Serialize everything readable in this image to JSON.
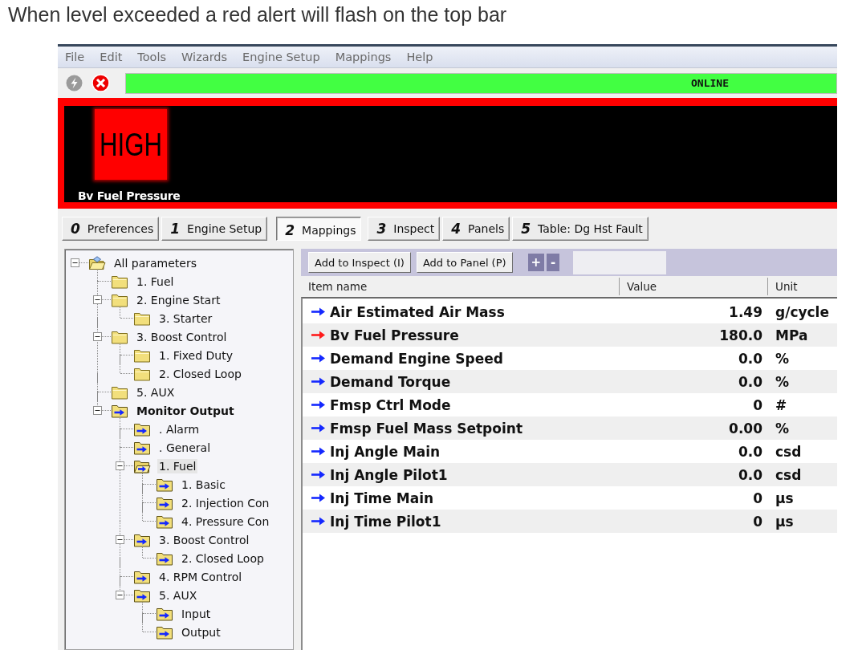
{
  "caption": "When level exceeded a red alert will flash on the top bar",
  "menu": [
    "File",
    "Edit",
    "Tools",
    "Wizards",
    "Engine Setup",
    "Mappings",
    "Help"
  ],
  "status": "ONLINE",
  "alert": {
    "badge": "HIGH",
    "parameter": "Bv Fuel Pressure"
  },
  "tabs": [
    {
      "number": "0",
      "label": "Preferences",
      "selected": false
    },
    {
      "number": "1",
      "label": "Engine Setup",
      "selected": false
    },
    {
      "number": "2",
      "label": "Mappings",
      "selected": true
    },
    {
      "number": "3",
      "label": "Inspect",
      "selected": false
    },
    {
      "number": "4",
      "label": "Panels",
      "selected": false
    },
    {
      "number": "5",
      "label": "Table: Dg Hst Fault",
      "selected": false
    }
  ],
  "tree": [
    {
      "label": "All parameters",
      "kind": "root",
      "expanded": true,
      "selected": false,
      "children": [
        {
          "label": "1. Fuel",
          "kind": "folder",
          "selected": false
        },
        {
          "label": "2. Engine Start",
          "kind": "folder",
          "expanded": true,
          "selected": false,
          "children": [
            {
              "label": "3. Starter",
              "kind": "folder",
              "selected": false
            }
          ]
        },
        {
          "label": "3. Boost Control",
          "kind": "folder",
          "expanded": true,
          "selected": false,
          "children": [
            {
              "label": "1. Fixed Duty",
              "kind": "folder",
              "selected": false
            },
            {
              "label": "2. Closed Loop",
              "kind": "folder",
              "selected": false
            }
          ]
        },
        {
          "label": "5. AUX",
          "kind": "folder",
          "selected": false
        },
        {
          "label": "Monitor Output",
          "kind": "output",
          "bold": true,
          "expanded": true,
          "selected": false,
          "children": [
            {
              "label": ". Alarm",
              "kind": "output",
              "selected": false
            },
            {
              "label": ". General",
              "kind": "output",
              "selected": false
            },
            {
              "label": "1. Fuel",
              "kind": "output",
              "expanded": true,
              "selected": true,
              "children": [
                {
                  "label": "1. Basic",
                  "kind": "output",
                  "selected": false
                },
                {
                  "label": "2. Injection Con",
                  "kind": "output",
                  "selected": false
                },
                {
                  "label": "4. Pressure Con",
                  "kind": "output",
                  "selected": false
                }
              ]
            },
            {
              "label": "3. Boost Control",
              "kind": "output",
              "expanded": true,
              "selected": false,
              "children": [
                {
                  "label": "2. Closed Loop",
                  "kind": "output",
                  "selected": false
                }
              ]
            },
            {
              "label": "4. RPM Control",
              "kind": "output",
              "selected": false
            },
            {
              "label": "5. AUX",
              "kind": "output",
              "expanded": true,
              "selected": false,
              "children": [
                {
                  "label": "Input",
                  "kind": "output",
                  "selected": false
                },
                {
                  "label": "Output",
                  "kind": "output",
                  "selected": false
                }
              ]
            }
          ]
        }
      ]
    }
  ],
  "panel": {
    "buttons": [
      "Add to Inspect (I)",
      "Add to Panel (P)"
    ],
    "edit_buttons": [
      "+",
      "-"
    ],
    "columns": [
      "Item name",
      "Value",
      "Unit"
    ],
    "rows": [
      {
        "name": "Air Estimated Air Mass",
        "value": "1.49",
        "unit": "g/cycle",
        "alert": false
      },
      {
        "name": "Bv Fuel Pressure",
        "value": "180.0",
        "unit": "MPa",
        "alert": true
      },
      {
        "name": "Demand Engine Speed",
        "value": "0.0",
        "unit": "%",
        "alert": false
      },
      {
        "name": "Demand Torque",
        "value": "0.0",
        "unit": "%",
        "alert": false
      },
      {
        "name": "Fmsp Ctrl Mode",
        "value": "0",
        "unit": "#",
        "alert": false
      },
      {
        "name": "Fmsp Fuel Mass Setpoint",
        "value": "0.00",
        "unit": "%",
        "alert": false
      },
      {
        "name": "Inj Angle Main",
        "value": "0.0",
        "unit": "csd",
        "alert": false
      },
      {
        "name": "Inj Angle Pilot1",
        "value": "0.0",
        "unit": "csd",
        "alert": false
      },
      {
        "name": "Inj Time Main",
        "value": "0",
        "unit": "µs",
        "alert": false
      },
      {
        "name": "Inj Time Pilot1",
        "value": "0",
        "unit": "µs",
        "alert": false
      }
    ]
  }
}
